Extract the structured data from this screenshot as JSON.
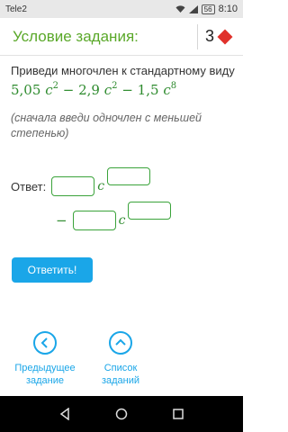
{
  "status_bar": {
    "carrier": "Tele2",
    "battery": "56",
    "time": "8:10"
  },
  "header": {
    "title": "Условие задания:",
    "count": "3"
  },
  "task": {
    "prompt": "Приведи многочлен к стандартному виду",
    "expr": {
      "coef1": "5,05",
      "exp1": "2",
      "op1": "−",
      "coef2": "2,9",
      "exp2": "2",
      "op2": "−",
      "coef3": "1,5",
      "exp3": "8",
      "var": "c"
    },
    "hint": "(сначала введи одночлен с меньшей степенью)"
  },
  "answer": {
    "label": "Ответ:",
    "var": "c",
    "minus": "−"
  },
  "submit_label": "Ответить!",
  "nav": {
    "prev_label_1": "Предыдущее",
    "prev_label_2": "задание",
    "list_label_1": "Список",
    "list_label_2": "заданий"
  },
  "colors": {
    "accent_green": "#5aa829",
    "accent_blue": "#1aa6e8",
    "diamond_red": "#e0312b"
  }
}
